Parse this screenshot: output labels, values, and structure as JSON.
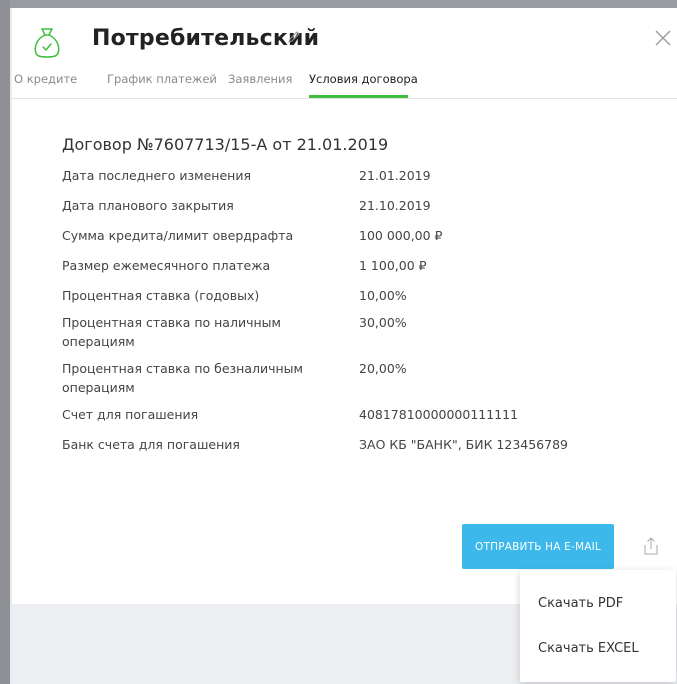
{
  "header": {
    "title": "Потребительский"
  },
  "tabs": [
    {
      "label": "О кредите",
      "active": false
    },
    {
      "label": "График платежей",
      "active": false
    },
    {
      "label": "Заявления",
      "active": false
    },
    {
      "label": "Условия договора",
      "active": true
    }
  ],
  "contract": {
    "title": "Договор №7607713/15-А от 21.01.2019",
    "rows": [
      {
        "label": "Дата последнего изменения",
        "value": "21.01.2019"
      },
      {
        "label": "Дата планового закрытия",
        "value": "21.10.2019"
      },
      {
        "label": "Сумма кредита/лимит овердрафта",
        "value": "100 000,00 ₽"
      },
      {
        "label": "Размер ежемесячного платежа",
        "value": "1 100,00 ₽"
      },
      {
        "label": "Процентная ставка (годовых)",
        "value": "10,00%"
      },
      {
        "label": "Процентная ставка по наличным операциям",
        "value": "30,00%"
      },
      {
        "label": "Процентная ставка по безналичным операциям",
        "value": "20,00%"
      },
      {
        "label": "Счет для погашения",
        "value": "40817810000000111111"
      },
      {
        "label": "Банк счета для погашения",
        "value": "ЗАО КБ \"БАНК\", БИК 123456789"
      }
    ]
  },
  "actions": {
    "email_button": "ОТПРАВИТЬ НА E-MAIL"
  },
  "export_menu": {
    "items": [
      "Скачать PDF",
      "Скачать EXCEL"
    ]
  },
  "colors": {
    "accent_green": "#3fbf3f",
    "button_blue": "#3cb8ea"
  }
}
